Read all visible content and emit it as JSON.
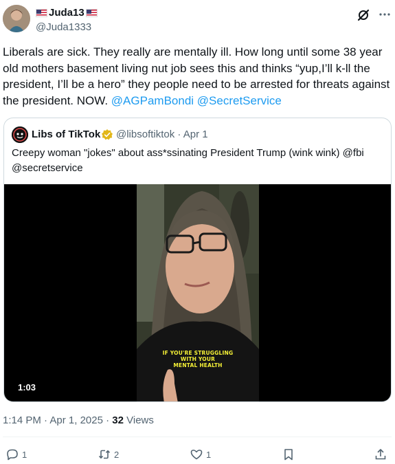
{
  "author": {
    "display_name": "Juda13",
    "handle": "@Juda1333"
  },
  "tweet": {
    "text_before": "Liberals are sick. They really are mentally ill. How long until some 38 year old mothers basement living nut job sees this and thinks “yup,I’ll k-ll the president, I’ll be a hero” they people need to be arrested for threats against the president. NOW. ",
    "mention_1": "@AGPamBondi",
    "space": " ",
    "mention_2": "@SecretService"
  },
  "quote": {
    "display_name": "Libs of TikTok",
    "handle": "@libsoftiktok",
    "separator": " · ",
    "date": "Apr 1",
    "text": "Creepy woman \"jokes\" about ass*ssinating President Trump (wink wink) @fbi @secretservice",
    "video": {
      "duration": "1:03",
      "caption_lines": [
        "IF YOU'RE STRUGGLING",
        "WITH YOUR",
        "MENTAL HEALTH"
      ]
    }
  },
  "meta": {
    "time": "1:14 PM",
    "separator": " · ",
    "date": "Apr 1, 2025",
    "views_count": "32",
    "views_label": " Views"
  },
  "actions": {
    "replies": "1",
    "reposts": "2",
    "likes": "1"
  },
  "icons": [
    "flag-us-icon",
    "grok-icon",
    "more-icon",
    "verified-badge-icon",
    "reply-icon",
    "repost-icon",
    "like-icon",
    "bookmark-icon",
    "share-icon"
  ],
  "colors": {
    "link": "#1d9bf0",
    "secondary_text": "#536471",
    "verified_gold": "#e2b719",
    "caption_yellow": "#f5f136"
  }
}
